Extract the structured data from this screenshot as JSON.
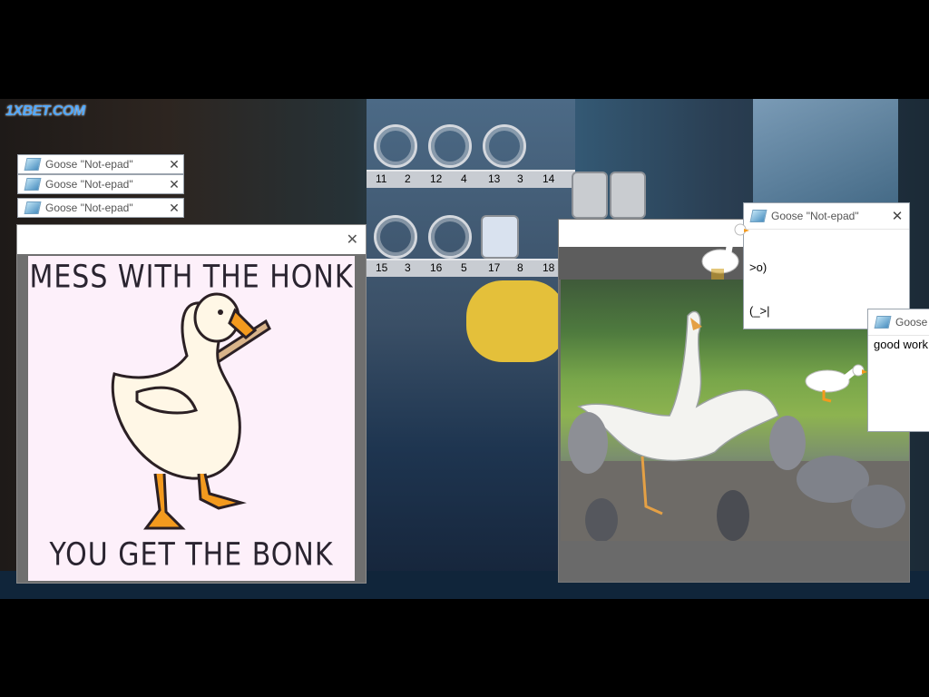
{
  "overlay": {
    "logo_text": "1XBET.COM"
  },
  "title_strips": [
    {
      "title": "Goose \"Not-epad\"",
      "close": "✕"
    },
    {
      "title": "Goose \"Not-epad\"",
      "close": "✕"
    },
    {
      "title": "Goose \"Not-epad\"",
      "close": "✕"
    }
  ],
  "honk_window": {
    "close": "✕",
    "poster_line1": "MESS WITH THE HONK",
    "poster_line2": "YOU GET THE BONK"
  },
  "notepad_ascii": {
    "title": "Goose \"Not-epad\"",
    "close": "✕",
    "lines": [
      ">o)",
      "(_>|"
    ]
  },
  "notepad_goodwork": {
    "title": "Goose \"",
    "text": "good work"
  },
  "vending_labels": [
    "11",
    "2",
    "12",
    "4",
    "13",
    "3",
    "14",
    "15",
    "3",
    "16",
    "5",
    "17",
    "8",
    "18"
  ],
  "colors": {
    "poster_bg": "#fdf0fa",
    "goose_body": "#fff7e6",
    "goose_beak": "#f39a1e",
    "bat": "#d9b48a"
  }
}
